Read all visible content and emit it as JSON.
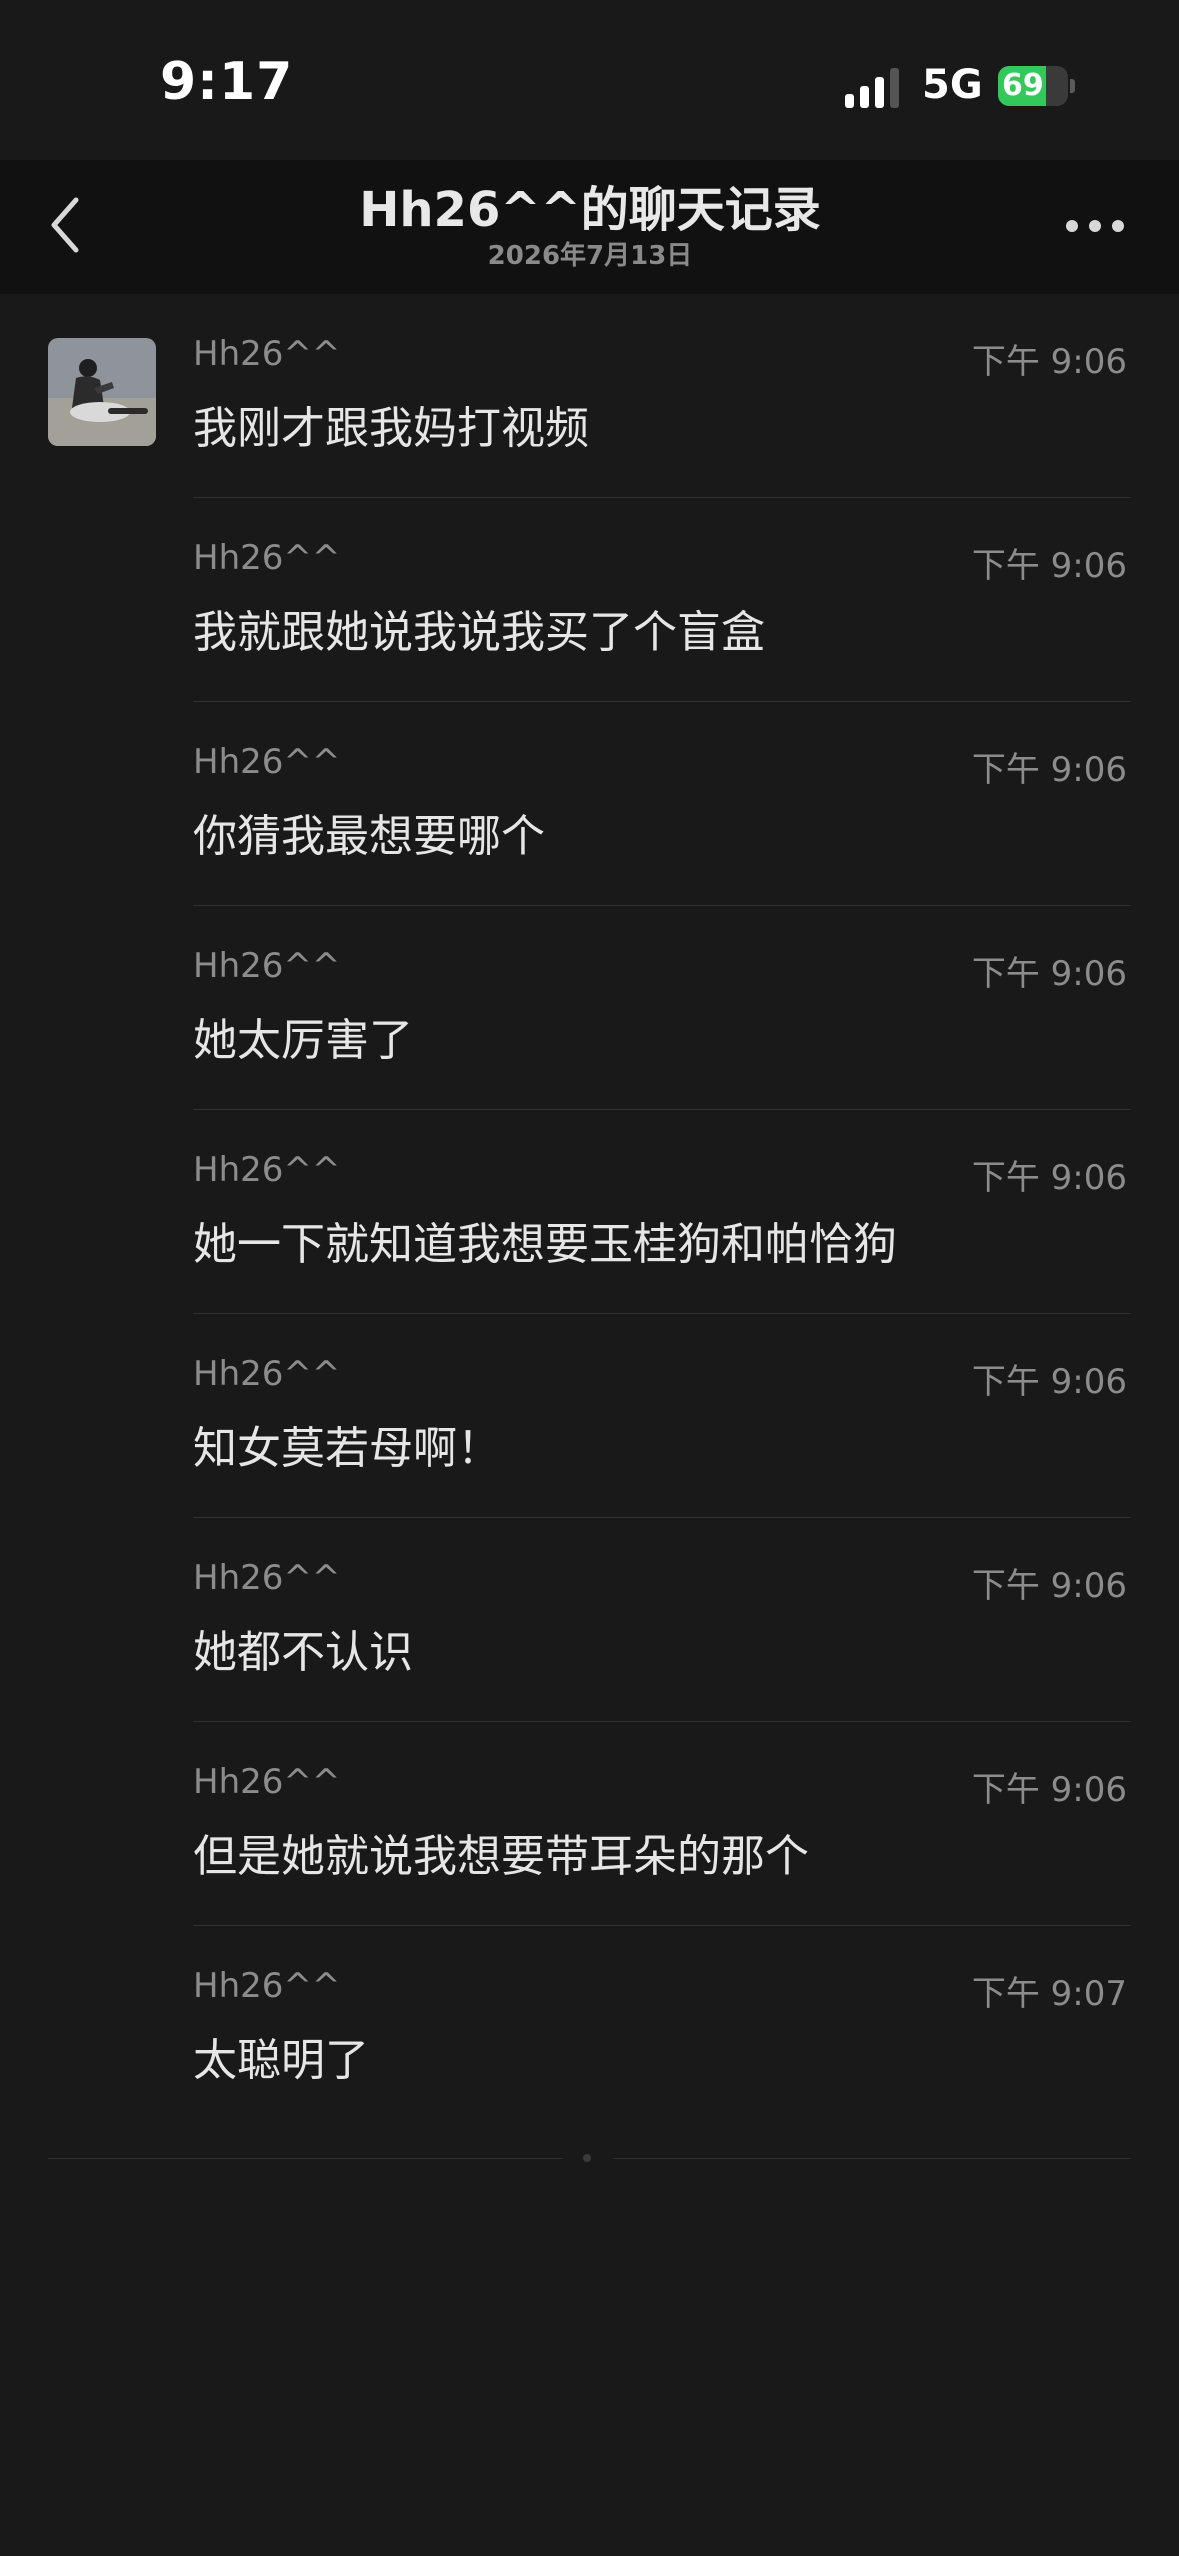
{
  "status_bar": {
    "time": "9:17",
    "network": "5G",
    "battery_level": "69",
    "battery_fraction": 0.69,
    "battery_color": "#34c759"
  },
  "nav": {
    "back_icon": "chevron-left-icon",
    "title": "Hh26^^的聊天记录",
    "subtitle": "2026年7月13日",
    "more_icon": "more-horizontal-icon"
  },
  "messages": [
    {
      "sender": "Hh26^^",
      "time": "下午 9:06",
      "text": "我刚才跟我妈打视频"
    },
    {
      "sender": "Hh26^^",
      "time": "下午 9:06",
      "text": "我就跟她说我说我买了个盲盒"
    },
    {
      "sender": "Hh26^^",
      "time": "下午 9:06",
      "text": "你猜我最想要哪个"
    },
    {
      "sender": "Hh26^^",
      "time": "下午 9:06",
      "text": "她太厉害了"
    },
    {
      "sender": "Hh26^^",
      "time": "下午 9:06",
      "text": "她一下就知道我想要玉桂狗和帕恰狗"
    },
    {
      "sender": "Hh26^^",
      "time": "下午 9:06",
      "text": "知女莫若母啊！"
    },
    {
      "sender": "Hh26^^",
      "time": "下午 9:06",
      "text": "她都不认识"
    },
    {
      "sender": "Hh26^^",
      "time": "下午 9:06",
      "text": "但是她就说我想要带耳朵的那个"
    },
    {
      "sender": "Hh26^^",
      "time": "下午 9:07",
      "text": "太聪明了"
    }
  ]
}
